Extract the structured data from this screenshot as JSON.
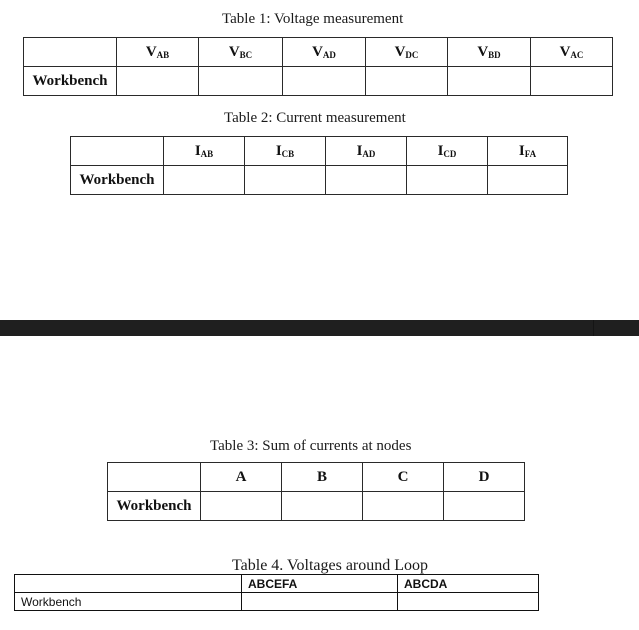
{
  "tables": [
    {
      "caption": "Table 1: Voltage measurement",
      "headers": [
        {
          "main": "V",
          "sub": "AB"
        },
        {
          "main": "V",
          "sub": "BC"
        },
        {
          "main": "V",
          "sub": "AD"
        },
        {
          "main": "V",
          "sub": "DC"
        },
        {
          "main": "V",
          "sub": "BD"
        },
        {
          "main": "V",
          "sub": "AC"
        }
      ],
      "row_label": "Workbench",
      "values": [
        "",
        "",
        "",
        "",
        "",
        ""
      ]
    },
    {
      "caption": "Table 2: Current measurement",
      "headers": [
        {
          "main": "I",
          "sub": "AB"
        },
        {
          "main": "I",
          "sub": "CB"
        },
        {
          "main": "I",
          "sub": "AD"
        },
        {
          "main": "I",
          "sub": "CD"
        },
        {
          "main": "I",
          "sub": "FA"
        }
      ],
      "row_label": "Workbench",
      "values": [
        "",
        "",
        "",
        "",
        ""
      ]
    },
    {
      "caption": "Table 3: Sum of currents at nodes",
      "headers": [
        "A",
        "B",
        "C",
        "D"
      ],
      "row_label": "Workbench",
      "values": [
        "",
        "",
        "",
        ""
      ]
    },
    {
      "caption": "Table 4. Voltages around Loop",
      "headers": [
        "ABCEFA",
        "ABCDA"
      ],
      "row_label": "Workbench",
      "values": [
        "",
        ""
      ]
    }
  ],
  "colors": {
    "border": "#2a2a2a",
    "separator_bar": "#1f1f1f",
    "background": "#ffffff"
  }
}
